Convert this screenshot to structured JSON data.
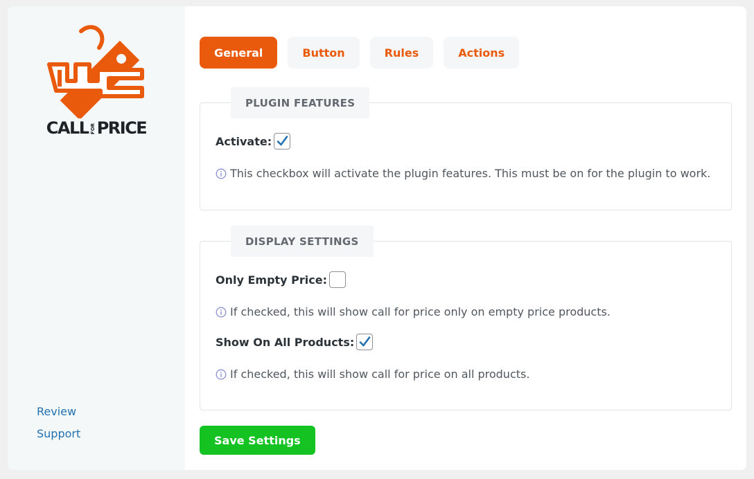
{
  "sidebar": {
    "logo_text": "CALL PRICE",
    "logo_small_text": "FOR",
    "links": [
      {
        "label": "Review"
      },
      {
        "label": "Support"
      }
    ]
  },
  "tabs": [
    {
      "label": "General",
      "active": true
    },
    {
      "label": "Button",
      "active": false
    },
    {
      "label": "Rules",
      "active": false
    },
    {
      "label": "Actions",
      "active": false
    }
  ],
  "plugin_features": {
    "legend": "PLUGIN FEATURES",
    "activate": {
      "label": "Activate:",
      "checked": true,
      "help": "This checkbox will activate the plugin features. This must be on for the plugin to work."
    }
  },
  "display_settings": {
    "legend": "DISPLAY SETTINGS",
    "only_empty_price": {
      "label": "Only Empty Price:",
      "checked": false,
      "help": "If checked, this will show call for price only on empty price products."
    },
    "show_on_all_products": {
      "label": "Show On All Products:",
      "checked": true,
      "help": "If checked, this will show call for price on all products."
    }
  },
  "save_label": "Save Settings",
  "colors": {
    "accent": "#ea5a0c",
    "save": "#14c322",
    "link": "#2271b1",
    "check": "#2271b1"
  },
  "icons": [
    "logo-tag-icon",
    "info-icon",
    "checkmark-icon"
  ]
}
